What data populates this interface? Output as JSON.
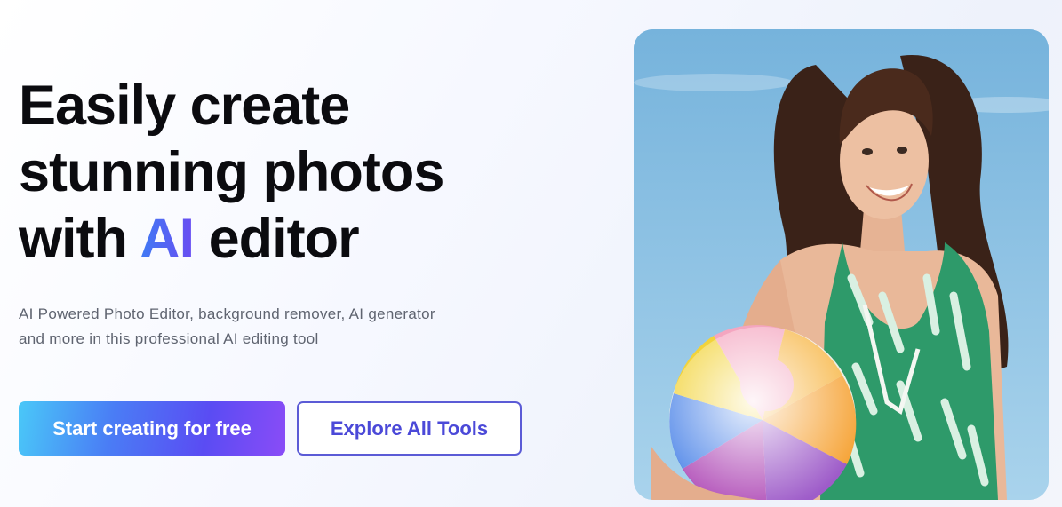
{
  "hero": {
    "headline": {
      "line1": "Easily create",
      "line2": "stunning photos",
      "line3_prefix": "with ",
      "line3_accent": "AI",
      "line3_suffix": " editor"
    },
    "subtext": {
      "line1": "AI Powered Photo Editor, background remover, AI generator",
      "line2": "and more in this professional AI editing tool"
    },
    "primary_button_label": "Start creating for free",
    "secondary_button_label": "Explore All Tools"
  },
  "colors": {
    "accent_gradient_start": "#3f7bf4",
    "accent_gradient_end": "#6a4cf2",
    "primary_button_start": "#4ac8f8",
    "primary_button_end": "#8a4cf7",
    "secondary_button_border": "#5b5bd6",
    "headline": "#0b0b0f",
    "subtext": "#5f6470"
  }
}
